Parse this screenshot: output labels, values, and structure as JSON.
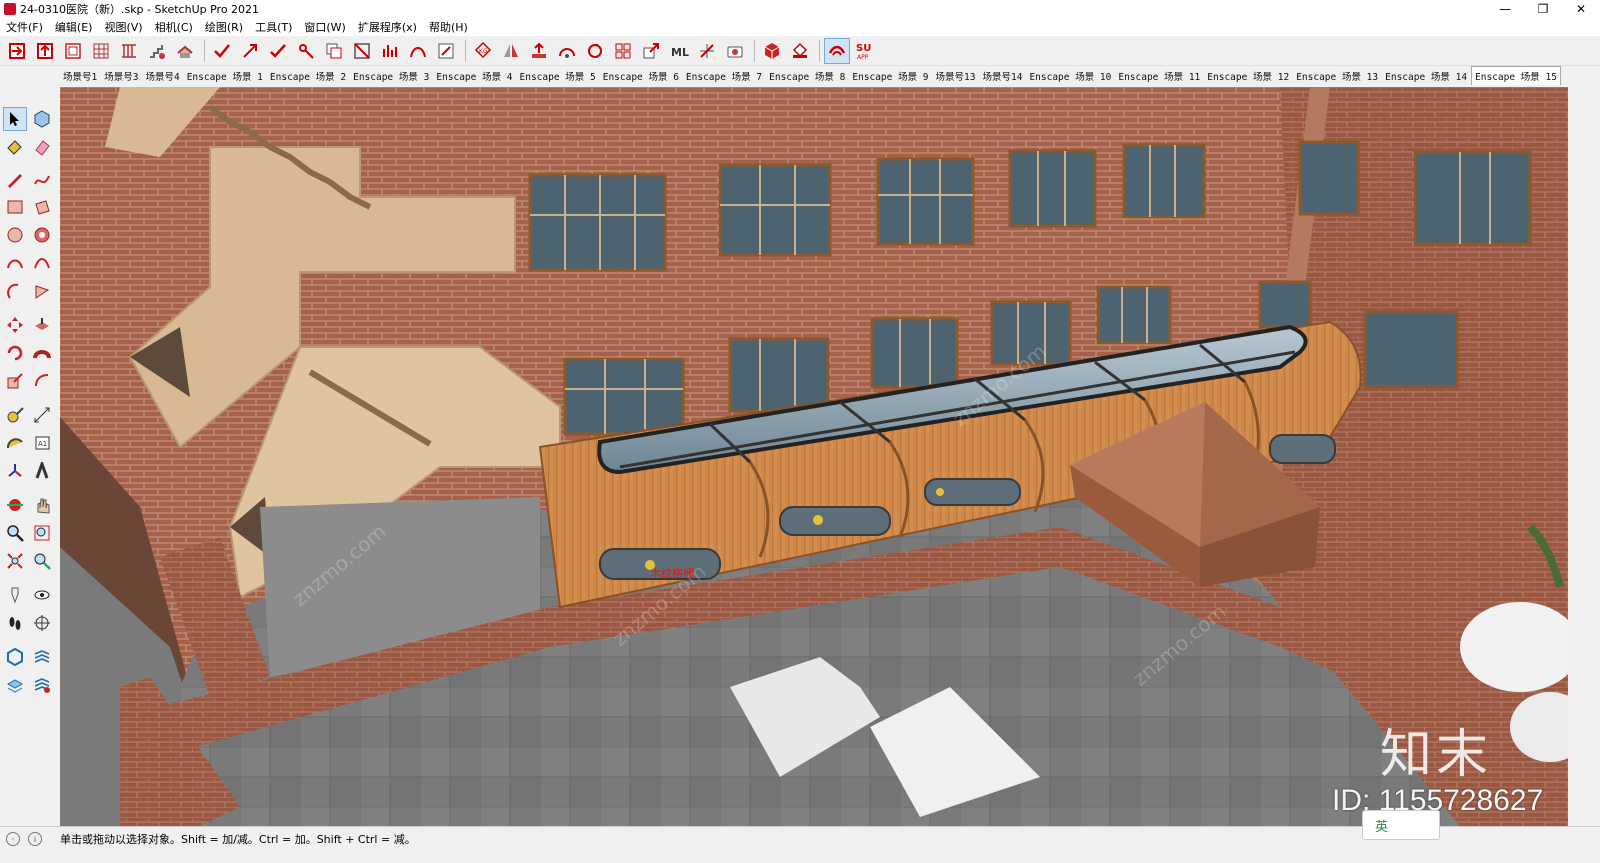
{
  "window": {
    "title": "24-0310医院（新）.skp - SketchUp Pro 2021",
    "minimize": "—",
    "maximize": "❐",
    "close": "✕"
  },
  "menu": {
    "items": [
      "文件(F)",
      "编辑(E)",
      "视图(V)",
      "相机(C)",
      "绘图(R)",
      "工具(T)",
      "窗口(W)",
      "扩展程序(x)",
      "帮助(H)"
    ]
  },
  "scenes": {
    "tabs": [
      "场景号1",
      "场景号3",
      "场景号4",
      "Enscape 场景 1",
      "Enscape 场景 2",
      "Enscape 场景 3",
      "Enscape 场景 4",
      "Enscape 场景 5",
      "Enscape 场景 6",
      "Enscape 场景 7",
      "Enscape 场景 8",
      "Enscape 场景 9",
      "场景号13",
      "场景号14",
      "Enscape 场景 10",
      "Enscape 场景 11",
      "Enscape 场景 12",
      "Enscape 场景 13",
      "Enscape 场景 14",
      "Enscape 场景 15"
    ],
    "active": "Enscape 场景 15"
  },
  "toolbar": {
    "su_app_label": "SU APP"
  },
  "viewport": {
    "annotation": "木纹格栅",
    "watermark_brand": "知末",
    "watermark_id": "ID: 1155728627",
    "colors": {
      "brick": "#a5614a",
      "mortar": "#c99b86",
      "concrete": "#7a7a7a",
      "wood": "#d08a4a",
      "glass": "#8fa6b4",
      "stair": "#d9b994"
    }
  },
  "status": {
    "message": "单击或拖动以选择对象。Shift = 加/减。Ctrl = 加。Shift + Ctrl = 减。"
  },
  "ime": {
    "label": "英"
  }
}
